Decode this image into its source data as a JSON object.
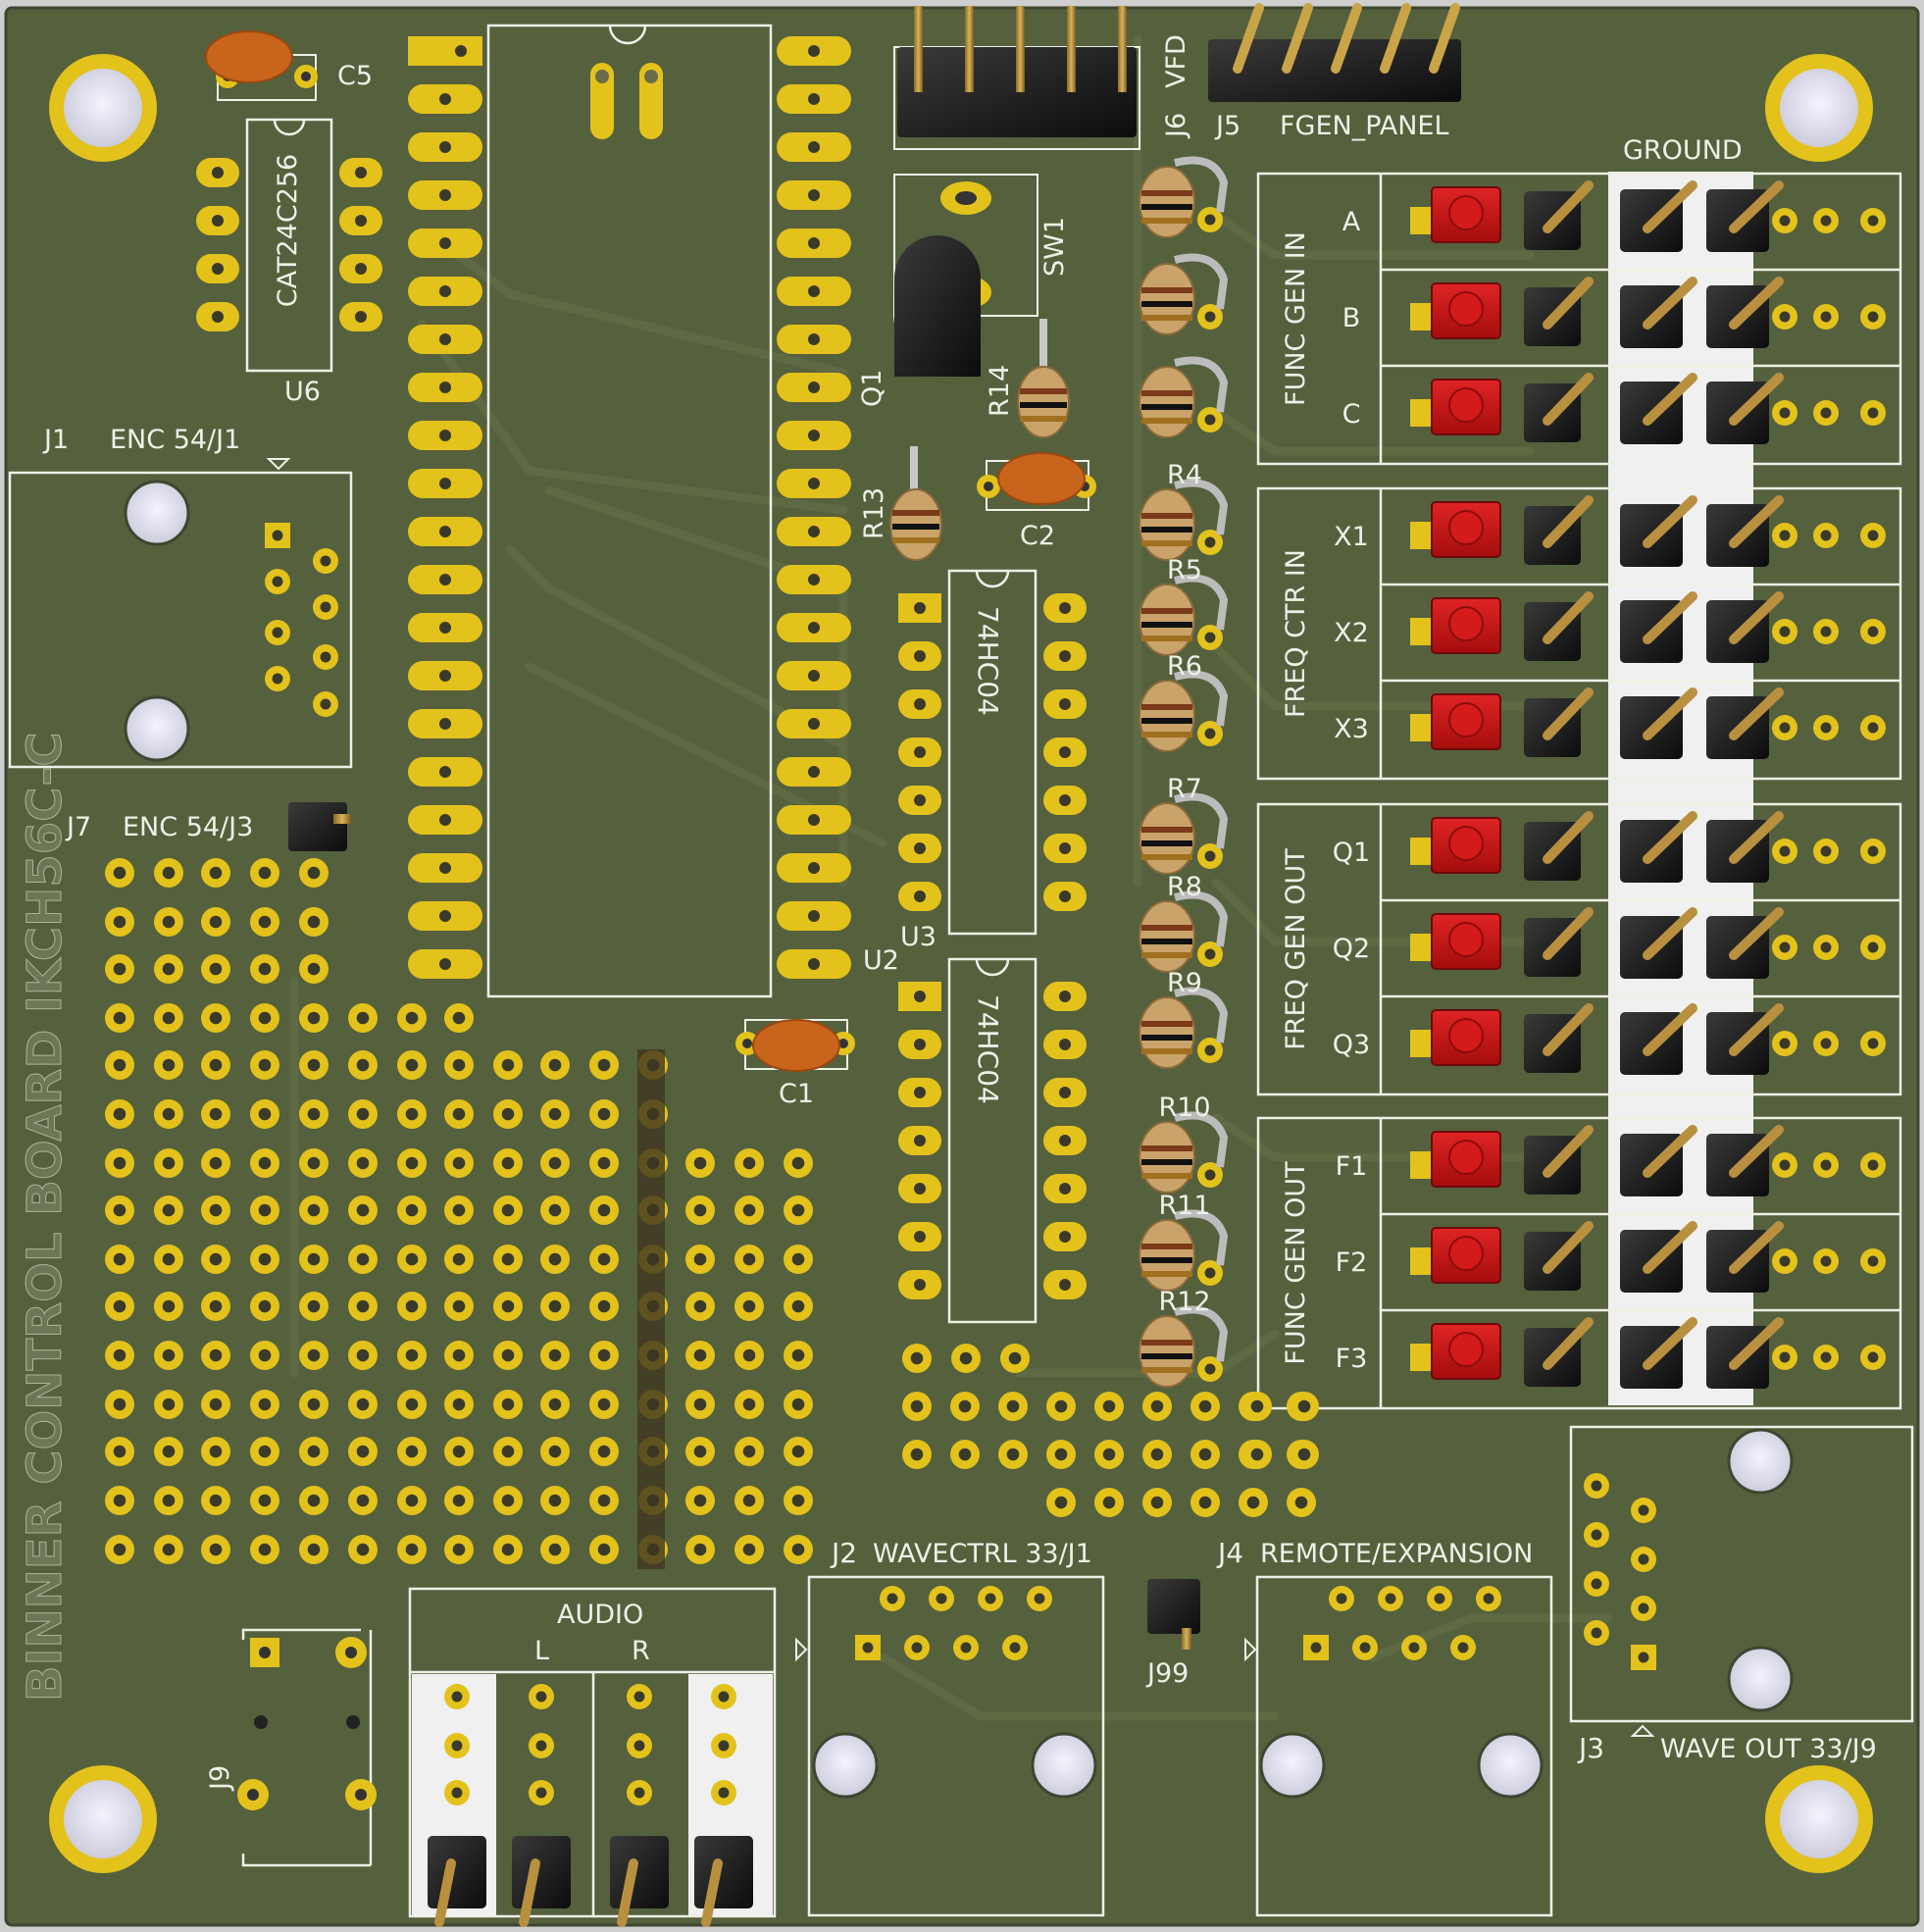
{
  "board": {
    "vertical_title": "BINNER CONTROL BOARD IKCH56C-C",
    "colors": {
      "board": "#55603d",
      "board_dark": "#4b5535",
      "trace": "#5e6a44",
      "copper": "#e3c21c",
      "silk": "#eef0e6",
      "white_header": "#f3f3f3",
      "red_button": "#d11717",
      "cap": "#c8641c",
      "resistor": "#c9a36a"
    }
  },
  "components": {
    "u6": {
      "ref": "U6",
      "value": "CAT24C256"
    },
    "c5": "C5",
    "j6": {
      "ref": "J6",
      "value": "VFD"
    },
    "j5": {
      "ref": "J5",
      "value": "FGEN_PANEL"
    },
    "sw1": "SW1",
    "q1": "Q1",
    "r14": "R14",
    "r13": "R13",
    "c2": "C2",
    "c1": "C1",
    "u2": "U2",
    "u3": {
      "ref": "U3",
      "value": "74HC04"
    },
    "u4_value": "74HC04",
    "j1": {
      "ref": "J1",
      "value": "ENC 54/J1"
    },
    "j7": {
      "ref": "J7",
      "value": "ENC 54/J3"
    },
    "j2": {
      "ref": "J2",
      "value": "WAVECTRL 33/J1"
    },
    "j4": {
      "ref": "J4",
      "value": "REMOTE/EXPANSION"
    },
    "j99": "J99",
    "j3": {
      "ref": "J3",
      "value": "WAVE OUT 33/J9"
    },
    "j9": "J9",
    "resistors": [
      "R4",
      "R5",
      "R6",
      "R7",
      "R8",
      "R9",
      "R10",
      "R11",
      "R12"
    ]
  },
  "panel": {
    "ground_label": "GROUND",
    "groups": [
      {
        "title": "FUNC GEN IN",
        "rows": [
          "A",
          "B",
          "C"
        ]
      },
      {
        "title": "FREQ CTR IN",
        "rows": [
          "X1",
          "X2",
          "X3"
        ]
      },
      {
        "title": "FREQ GEN OUT",
        "rows": [
          "Q1",
          "Q2",
          "Q3"
        ]
      },
      {
        "title": "FUNC GEN OUT",
        "rows": [
          "F1",
          "F2",
          "F3"
        ]
      }
    ]
  },
  "audio": {
    "title": "AUDIO",
    "left": "L",
    "right": "R"
  }
}
